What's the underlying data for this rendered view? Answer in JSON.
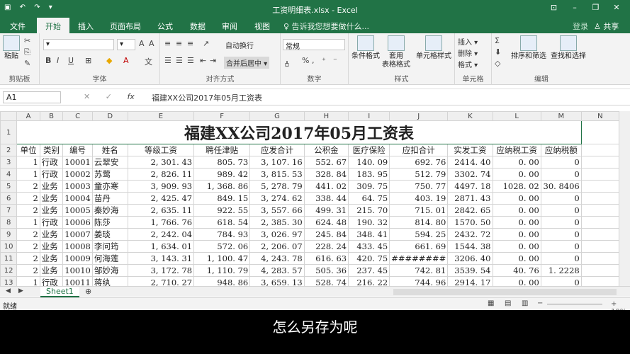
{
  "titlebar": {
    "title": "工资明细表.xlsx - Excel"
  },
  "tabs": [
    "文件",
    "开始",
    "插入",
    "页面布局",
    "公式",
    "数据",
    "审阅",
    "视图"
  ],
  "tell_me": "♀ 告诉我您想要做什么...",
  "login": "登录",
  "share": "♙ 共享",
  "ribbon": {
    "paste": "粘贴",
    "clipboard": "剪贴板",
    "font": "字体",
    "alignment": "对齐方式",
    "wrap": "自动换行",
    "merge": "合并后居中 ▾",
    "number_format": "常规",
    "number": "数字",
    "cond_format": "条件格式",
    "table_format": "套用\n表格格式",
    "cell_style": "单元格样式",
    "styles": "样式",
    "insert": "插入 ▾",
    "delete": "删除 ▾",
    "format": "格式 ▾",
    "cells": "单元格",
    "sort_filter": "排序和筛选",
    "find_select": "查找和选择",
    "editing": "编辑"
  },
  "formula_bar": {
    "name_box": "A1",
    "fx": "fx",
    "content": "福建XX公司2017年05月工资表"
  },
  "sheet": {
    "columns": [
      "A",
      "B",
      "C",
      "D",
      "E",
      "F",
      "G",
      "H",
      "I",
      "J",
      "K",
      "L",
      "M",
      "N"
    ],
    "row_numbers": [
      "1",
      "2",
      "3",
      "4",
      "5",
      "6",
      "7",
      "8",
      "9",
      "10",
      "11",
      "12",
      "13"
    ],
    "title": "福建XX公司2017年05月工资表",
    "headers": [
      "单位",
      "类别",
      "编号",
      "姓名",
      "等级工资",
      "聘任津贴",
      "应发合计",
      "公积金",
      "医疗保险",
      "应扣合计",
      "实发工资",
      "应纳税工资",
      "应纳税额"
    ],
    "rows": [
      [
        "1",
        "行政",
        "10001",
        "云翠安",
        "2, 301. 43",
        "805. 73",
        "3, 107. 16",
        "552. 67",
        "140. 09",
        "692. 76",
        "2414. 40",
        "0. 00",
        "0"
      ],
      [
        "1",
        "行政",
        "10002",
        "苏莺",
        "2, 826. 11",
        "989. 42",
        "3, 815. 53",
        "328. 84",
        "183. 95",
        "512. 79",
        "3302. 74",
        "0. 00",
        "0"
      ],
      [
        "2",
        "业务",
        "10003",
        "童亦寒",
        "3, 909. 93",
        "1, 368. 86",
        "5, 278. 79",
        "441. 02",
        "309. 75",
        "750. 77",
        "4497. 18",
        "1028. 02",
        "30. 8406"
      ],
      [
        "2",
        "业务",
        "10004",
        "苗丹",
        "2, 425. 47",
        "849. 15",
        "3, 274. 62",
        "338. 44",
        "64. 75",
        "403. 19",
        "2871. 43",
        "0. 00",
        "0"
      ],
      [
        "2",
        "业务",
        "10005",
        "秦妙海",
        "2, 635. 11",
        "922. 55",
        "3, 557. 66",
        "499. 31",
        "215. 70",
        "715. 01",
        "2842. 65",
        "0. 00",
        "0"
      ],
      [
        "1",
        "行政",
        "10006",
        "陈莎",
        "1, 766. 76",
        "618. 54",
        "2, 385. 30",
        "624. 48",
        "190. 32",
        "814. 80",
        "1570. 50",
        "0. 00",
        "0"
      ],
      [
        "2",
        "业务",
        "10007",
        "姜琰",
        "2, 242. 04",
        "784. 93",
        "3, 026. 97",
        "245. 84",
        "348. 41",
        "594. 25",
        "2432. 72",
        "0. 00",
        "0"
      ],
      [
        "2",
        "业务",
        "10008",
        "李问筠",
        "1, 634. 01",
        "572. 06",
        "2, 206. 07",
        "228. 24",
        "433. 45",
        "661. 69",
        "1544. 38",
        "0. 00",
        "0"
      ],
      [
        "2",
        "业务",
        "10009",
        "何海莲",
        "3, 143. 31",
        "1, 100. 47",
        "4, 243. 78",
        "616. 63",
        "420. 75",
        "########",
        "3206. 40",
        "0. 00",
        "0"
      ],
      [
        "2",
        "业务",
        "10010",
        "邹妙海",
        "3, 172. 78",
        "1, 110. 79",
        "4, 283. 57",
        "505. 36",
        "237. 45",
        "742. 81",
        "3539. 54",
        "40. 76",
        "1. 2228"
      ],
      [
        "1",
        "行政",
        "10011",
        "蒋纨",
        "2, 710. 27",
        "948. 86",
        "3, 659. 13",
        "528. 74",
        "216. 22",
        "744. 96",
        "2914. 17",
        "0. 00",
        "0"
      ]
    ]
  },
  "sheet_tab": "Sheet1",
  "status": {
    "ready": "就绪",
    "zoom": "+ 10%"
  },
  "subtitle": "怎么另存为呢"
}
